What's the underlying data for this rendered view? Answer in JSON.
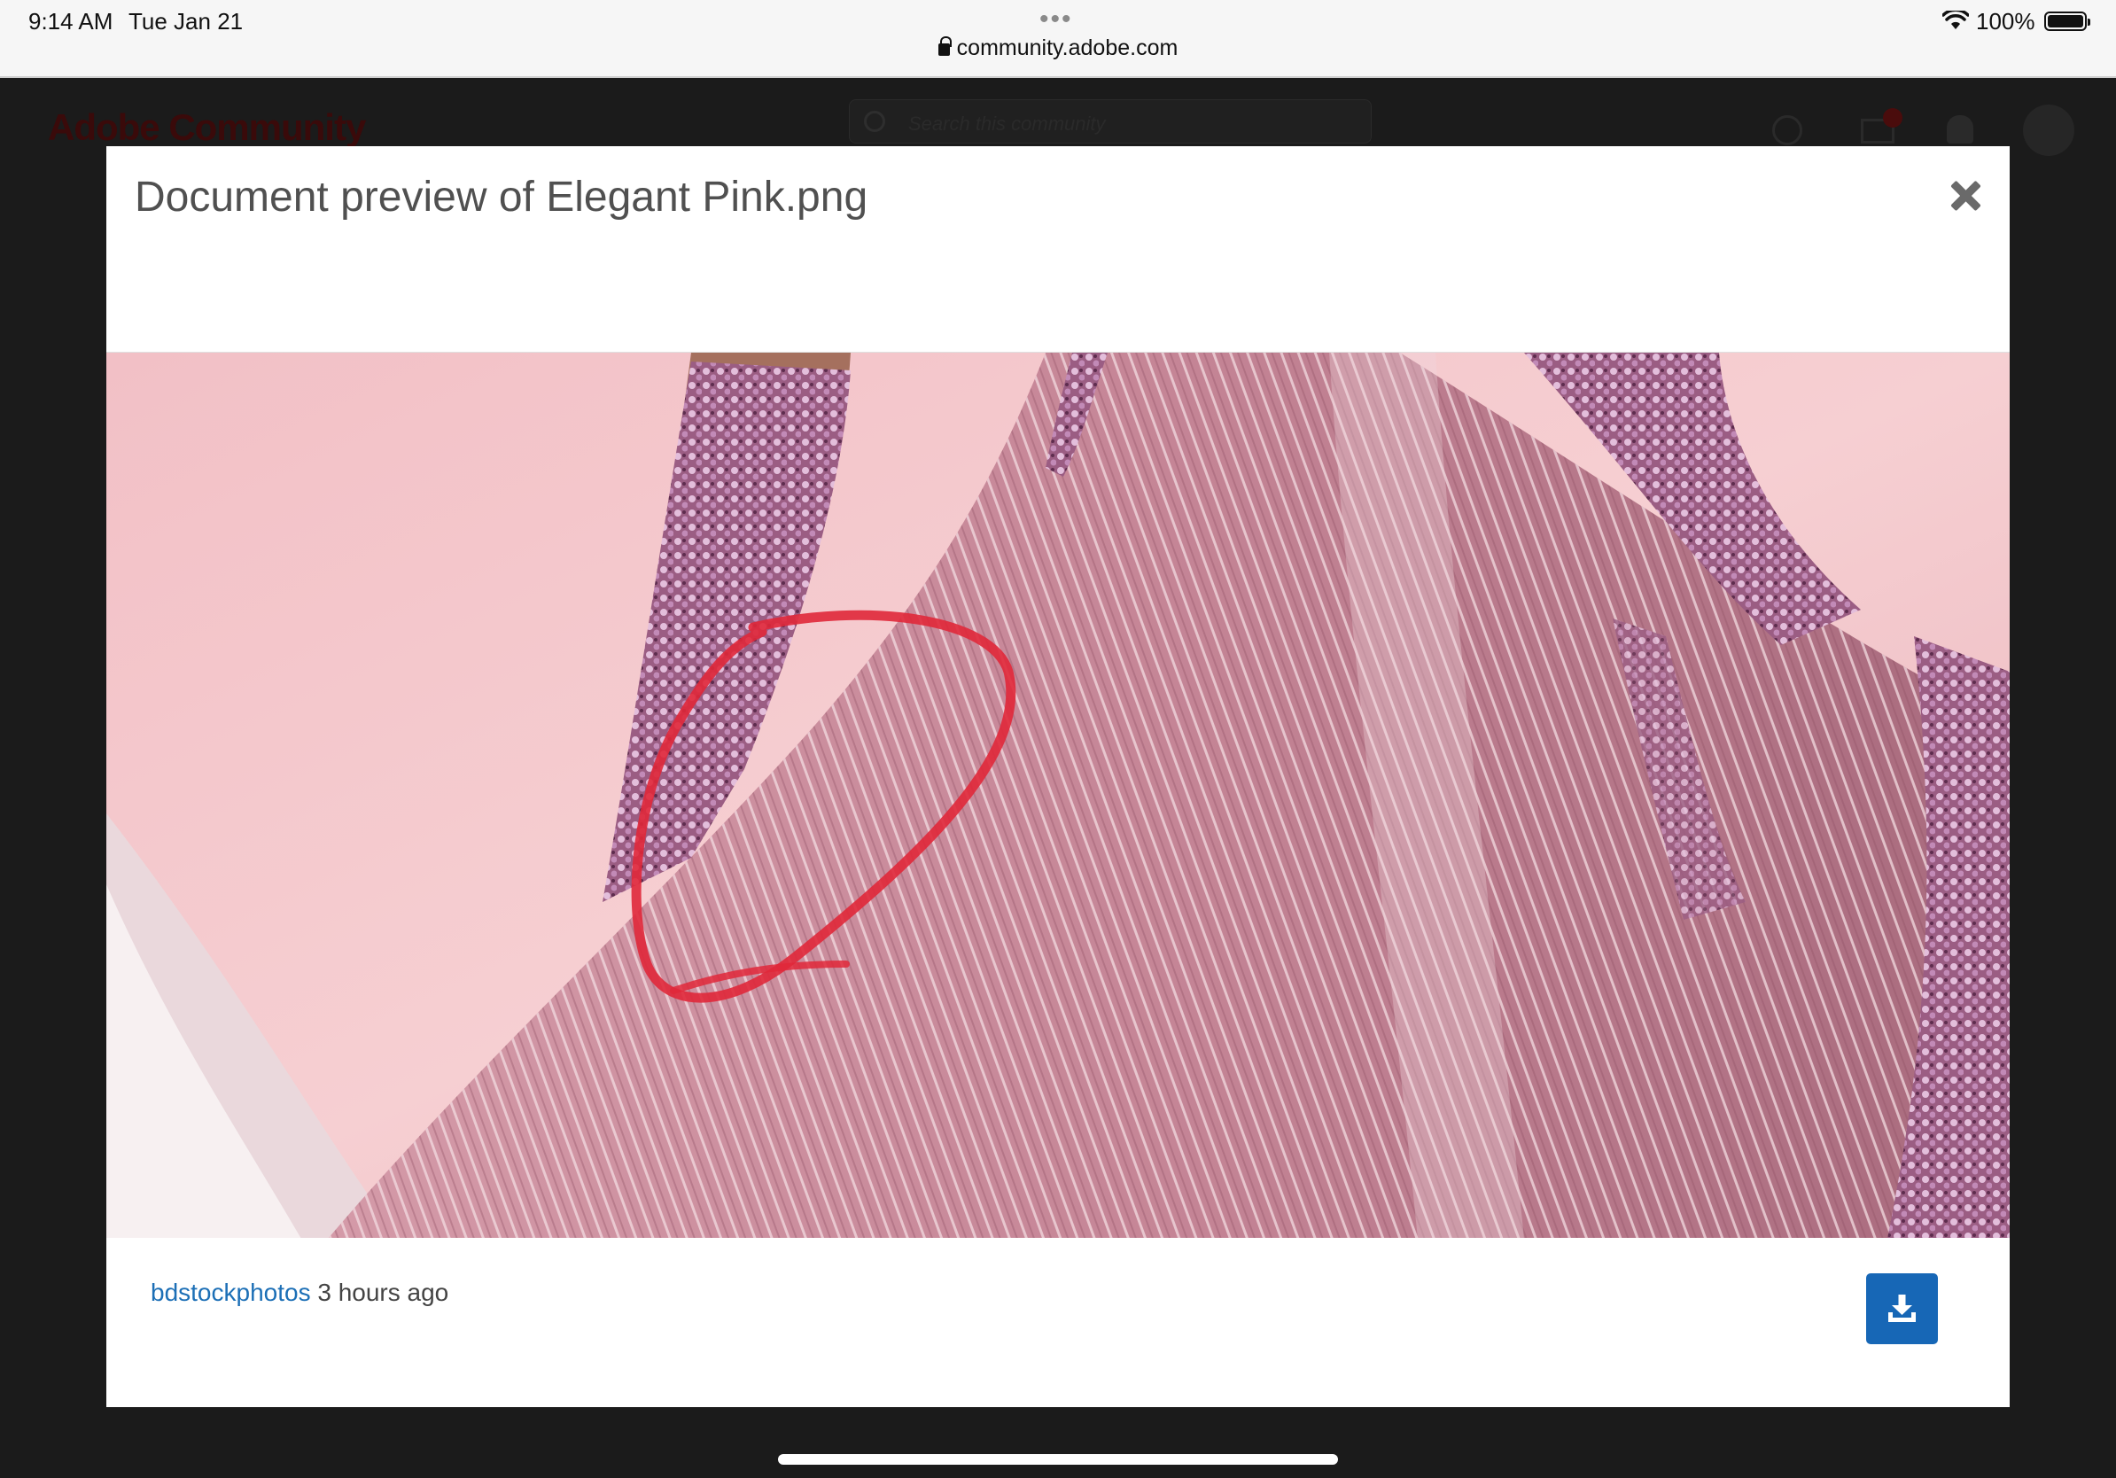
{
  "status_bar": {
    "time": "9:14 AM",
    "date": "Tue Jan 21",
    "dots": "•••",
    "url": "community.adobe.com",
    "battery_text": "100%"
  },
  "site_header": {
    "logo": "Adobe Community",
    "search_placeholder": "Search this community"
  },
  "modal": {
    "title": "Document preview of Elegant Pink.png",
    "author": "bdstockphotos",
    "posted": "3 hours ago"
  },
  "icons": {
    "lock": "lock-icon",
    "wifi": "wifi-icon",
    "battery": "battery-icon",
    "close": "close-icon",
    "download": "download-icon",
    "search": "search-icon",
    "globe": "globe-icon",
    "mail": "mail-icon",
    "bell": "bell-icon"
  },
  "colors": {
    "accent": "#1767b6",
    "link": "#1c6fb6",
    "annotation": "#e0283a"
  }
}
